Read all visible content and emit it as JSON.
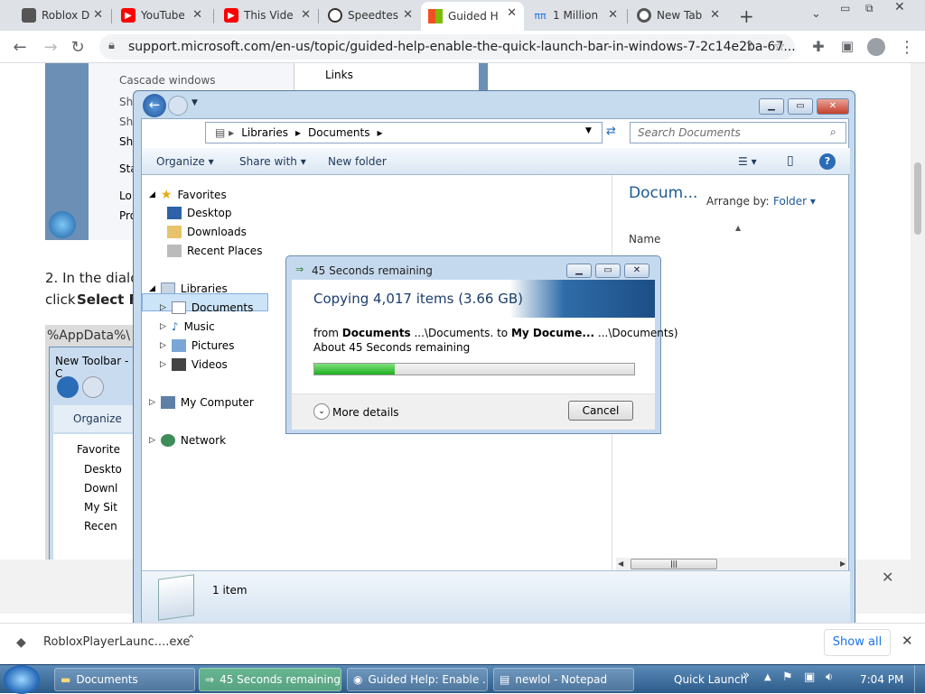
{
  "browser": {
    "tabs": [
      {
        "title": "Roblox D",
        "icon": "roblox-icon"
      },
      {
        "title": "YouTube",
        "icon": "youtube-icon"
      },
      {
        "title": "This Vide",
        "icon": "youtube-icon"
      },
      {
        "title": "Speedtes",
        "icon": "speedtest-icon"
      },
      {
        "title": "Guided H",
        "icon": "microsoft-icon",
        "active": true
      },
      {
        "title": "1 Million",
        "icon": "pi-icon"
      },
      {
        "title": "New Tab",
        "icon": "chrome-icon"
      }
    ],
    "new_tab": "+",
    "url": "support.microsoft.com/en-us/topic/guided-help-enable-the-quick-launch-bar-in-windows-7-2c14e2ba-67..."
  },
  "article": {
    "menu_items": [
      "Cascade windows",
      "Sh",
      "Sh",
      "Sh",
      "Sta",
      "Lo",
      "Pro"
    ],
    "links_label": "Links",
    "step_text": "2. In the dialo",
    "step_click": "click",
    "step_bold": "Select Fo",
    "code_text": "%AppData%\\",
    "inner_title": "New Toolbar - C",
    "inner_organize": "Organize",
    "inner_nav": [
      "Favorite",
      "Deskto",
      "Downl",
      "My Sit",
      "Recen"
    ]
  },
  "explorer": {
    "breadcrumb": [
      "Libraries",
      "Documents"
    ],
    "search_placeholder": "Search Documents",
    "commands": {
      "organize": "Organize",
      "share": "Share with",
      "new_folder": "New folder"
    },
    "nav": {
      "favorites": "Favorites",
      "fav_items": [
        "Desktop",
        "Downloads",
        "Recent Places"
      ],
      "libraries": "Libraries",
      "lib_items": [
        "Documents",
        "Music",
        "Pictures",
        "Videos"
      ],
      "computer": "My Computer",
      "network": "Network"
    },
    "pane_title": "Docum...",
    "arrange_label": "Arrange by:",
    "arrange_value": "Folder",
    "column_name": "Name",
    "status": "1 item"
  },
  "copy_dialog": {
    "title": "45 Seconds remaining",
    "heading": "Copying 4,017 items (3.66 GB)",
    "from_prefix": "from",
    "from_name": "Documents",
    "from_path": "...\\Documents.",
    "to_prefix": "to",
    "to_name": "My Docume...",
    "to_path": "...\\Documents)",
    "remaining": "About 45 Seconds remaining",
    "progress": 0.25,
    "more_details": "More details",
    "cancel": "Cancel"
  },
  "download_bar": {
    "file": "RobloxPlayerLaunc....exe",
    "show_all": "Show all"
  },
  "taskbar": {
    "items": [
      "Documents",
      "45 Seconds remaining",
      "Guided Help: Enable ...",
      "newlol - Notepad"
    ],
    "quick_launch": "Quick Launch",
    "chevron": "»",
    "clock": "7:04 PM"
  }
}
